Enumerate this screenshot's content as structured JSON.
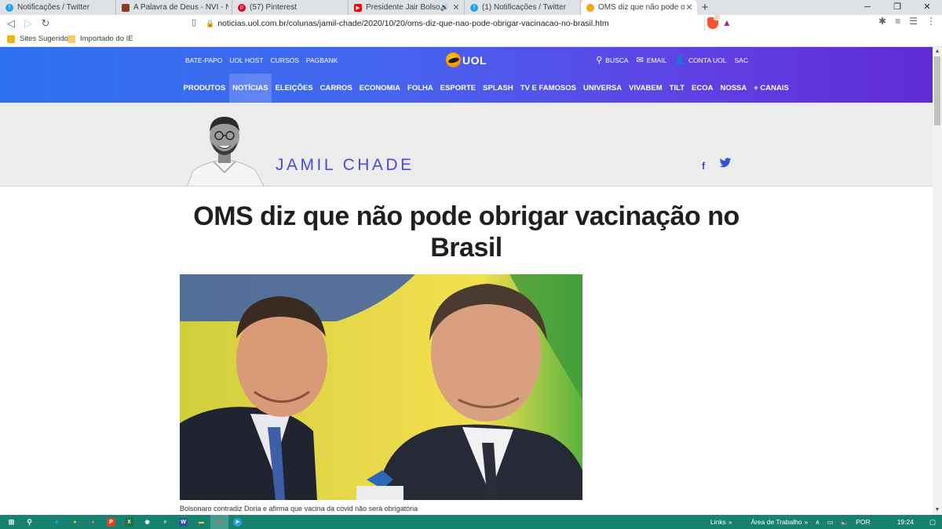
{
  "browser": {
    "tabs": [
      {
        "title": "Notificações / Twitter",
        "favicon": "twitter-icon",
        "color": "#1da1f2",
        "active": false
      },
      {
        "title": "A Palavra de Deus - NVI - Nova Ve",
        "favicon": "bible-icon",
        "color": "#8b3a2a",
        "active": false
      },
      {
        "title": "(57) Pinterest",
        "favicon": "pinterest-icon",
        "color": "#e60023",
        "active": false
      },
      {
        "title": "Presidente Jair Bolsonaro - Liv",
        "favicon": "youtube-icon",
        "color": "#ff0000",
        "active": false,
        "audio": true
      },
      {
        "title": "(1) Notificações / Twitter",
        "favicon": "twitter-icon",
        "color": "#1da1f2",
        "active": false
      },
      {
        "title": "OMS diz que não pode obrigar va",
        "favicon": "uol-icon",
        "color": "#f7a400",
        "active": true
      }
    ],
    "url": "noticias.uol.com.br/colunas/jamil-chade/2020/10/20/oms-diz-que-nao-pode-obrigar-vacinacao-no-brasil.htm",
    "bookmarks": [
      {
        "label": "Sites Sugeridos",
        "icon": "bing-icon",
        "color": "#f5b400"
      },
      {
        "label": "Importado do IE",
        "icon": "folder-icon",
        "color": "#f3cf6a"
      }
    ]
  },
  "uol": {
    "top_links": [
      "BATE-PAPO",
      "UOL HOST",
      "CURSOS",
      "PAGBANK"
    ],
    "logo_text": "UOL",
    "right_links": {
      "search": "BUSCA",
      "email": "EMAIL",
      "account": "CONTA UOL",
      "sac": "SAC"
    },
    "sections": [
      "PRODUTOS",
      "NOTÍCIAS",
      "ELEIÇÕES",
      "CARROS",
      "ECONOMIA",
      "FOLHA",
      "ESPORTE",
      "SPLASH",
      "TV E FAMOSOS",
      "UNIVERSA",
      "VIVABEM",
      "TILT",
      "ECOA",
      "NOSSA",
      "+ CANAIS"
    ],
    "active_section": "NOTÍCIAS",
    "brand_colors": {
      "gradient_start": "#2e71ee",
      "gradient_end": "#5f2bd7",
      "author": "#4b4bd8"
    }
  },
  "column": {
    "author": "JAMIL CHADE",
    "share": {
      "facebook": "f",
      "twitter": "🐦"
    }
  },
  "article": {
    "headline": "OMS diz que não pode obrigar vacinação no Brasil",
    "caption": "Bolsonaro contradiz Doria e afirma que vacina da covid não será obrigatória"
  },
  "taskbar": {
    "apps": [
      {
        "name": "ie-icon",
        "glyph": "e",
        "color": "#1fb5e9"
      },
      {
        "name": "chrome-icon",
        "glyph": "●",
        "color": "#fbbc05"
      },
      {
        "name": "firefox-icon",
        "glyph": "●",
        "color": "#ff7139"
      },
      {
        "name": "powerpoint-icon",
        "glyph": "P",
        "color": "#d24726"
      },
      {
        "name": "excel-icon",
        "glyph": "X",
        "color": "#1d6f42"
      },
      {
        "name": "whatsapp-icon",
        "glyph": "◉",
        "color": "#25d366"
      },
      {
        "name": "edge-icon",
        "glyph": "e",
        "color": "#3277bc"
      },
      {
        "name": "word-icon",
        "glyph": "W",
        "color": "#2b579a"
      },
      {
        "name": "file-explorer-icon",
        "glyph": "▬",
        "color": "#f3c447"
      },
      {
        "name": "brave-icon",
        "glyph": "▼",
        "color": "#fb542b",
        "active": true
      },
      {
        "name": "telegram-icon",
        "glyph": "➤",
        "color": "#2aa1da"
      }
    ],
    "links_label": "Links",
    "desktop_label": "Área de Trabalho",
    "language": "POR",
    "time": "19:24"
  }
}
